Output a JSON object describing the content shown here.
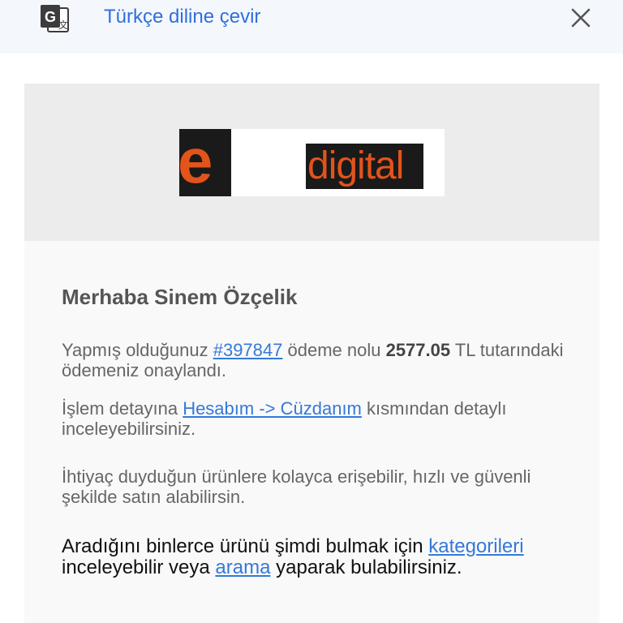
{
  "translate_bar": {
    "label": "Türkçe diline çevir",
    "icon": "google-translate-icon",
    "close_icon": "close-icon"
  },
  "logo": {
    "left_letter": "e",
    "right_word": "digital",
    "brand_color": "#e2541b"
  },
  "email": {
    "greeting": "Merhaba Sinem Özçelik",
    "p1": {
      "before": "Yapmış olduğunuz ",
      "order_link": "#397847",
      "middle": " ödeme nolu ",
      "amount": "2577.05",
      "after": " TL tutarındaki ödemeniz onaylandı."
    },
    "p2": {
      "before": "İşlem detayına ",
      "link": "Hesabım -> Cüzdanım",
      "after": " kısmından detaylı inceleyebilirsiniz."
    },
    "p3": {
      "text": "İhtiyaç duyduğun ürünlere kolayca erişebilir, hızlı ve güvenli şekilde satın alabilirsin."
    },
    "p4": {
      "before": "Aradığını binlerce ürünü şimdi bulmak için ",
      "categories_link": "kategorileri",
      "middle": " inceleyebilir veya ",
      "search_link": "arama",
      "after": " yaparak bulabilirsiniz."
    }
  },
  "colors": {
    "link": "#3579d8",
    "translate_text": "#2f6fde",
    "header_band": "#ececec"
  }
}
